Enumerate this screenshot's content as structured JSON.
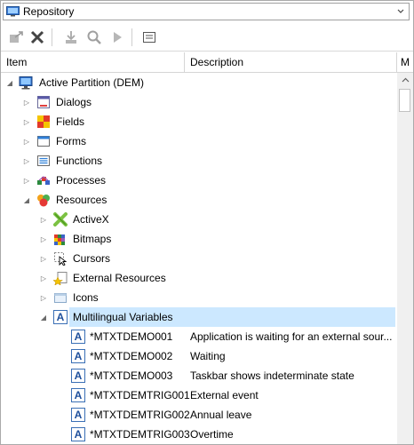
{
  "repository_select": {
    "value": "Repository",
    "icon": "repository-icon"
  },
  "toolbar": {
    "buttons": [
      {
        "name": "export-button",
        "icon": "export-icon"
      },
      {
        "name": "delete-button",
        "icon": "delete-x-icon"
      },
      {
        "name": "import-button",
        "icon": "import-icon"
      },
      {
        "name": "find-button",
        "icon": "search-icon"
      },
      {
        "name": "run-button",
        "icon": "play-icon"
      },
      {
        "name": "details-button",
        "icon": "details-icon"
      }
    ]
  },
  "columns": {
    "item": "Item",
    "description": "Description",
    "more": "M"
  },
  "tree": {
    "root": {
      "label": "Active Partition (DEM)",
      "icon": "monitor-icon"
    },
    "dialogs": "Dialogs",
    "fields": "Fields",
    "forms": "Forms",
    "functions": "Functions",
    "processes": "Processes",
    "resources": "Resources",
    "activex": "ActiveX",
    "bitmaps": "Bitmaps",
    "cursors": "Cursors",
    "external_resources": "External Resources",
    "icons": "Icons",
    "multilingual": "Multilingual Variables",
    "variables": [
      {
        "name": "*MTXTDEMO001",
        "description": "Application is waiting for an external sour..."
      },
      {
        "name": "*MTXTDEMO002",
        "description": "Waiting"
      },
      {
        "name": "*MTXTDEMO003",
        "description": "Taskbar shows indeterminate state"
      },
      {
        "name": "*MTXTDEMTRIG001",
        "description": "External event"
      },
      {
        "name": "*MTXTDEMTRIG002",
        "description": "Annual leave"
      },
      {
        "name": "*MTXTDEMTRIG003",
        "description": "Overtime"
      }
    ]
  },
  "colors": {
    "selection": "#cce8ff",
    "accent": "#1e4f9c"
  }
}
